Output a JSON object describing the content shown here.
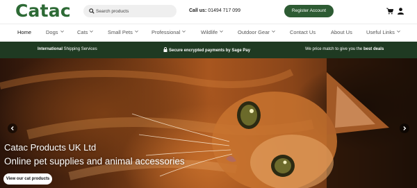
{
  "header": {
    "logo": "Catac",
    "search": {
      "placeholder": "Search products",
      "icon": "search-icon"
    },
    "call_label": "Call us:",
    "call_number": "01494 717 099",
    "register_label": "Register Account",
    "icons": [
      "cart-icon",
      "user-icon"
    ],
    "brand_color": "#2d6a35"
  },
  "nav": {
    "items": [
      {
        "label": "Home",
        "dropdown": false,
        "active": true
      },
      {
        "label": "Dogs",
        "dropdown": true
      },
      {
        "label": "Cats",
        "dropdown": true
      },
      {
        "label": "Small Pets",
        "dropdown": true
      },
      {
        "label": "Professional",
        "dropdown": true
      },
      {
        "label": "Wildlife",
        "dropdown": true
      },
      {
        "label": "Outdoor Gear",
        "dropdown": true
      },
      {
        "label": "Contact Us",
        "dropdown": false
      },
      {
        "label": "About Us",
        "dropdown": false
      },
      {
        "label": "Useful Links",
        "dropdown": true
      }
    ]
  },
  "promo": {
    "international_bold": "International",
    "international_rest": " Shipping Services",
    "secure": "Secure encrypted payments by Sage Pay",
    "price_match_rest": "We price match to give you the ",
    "price_match_bold": "best deals",
    "background": "#1f3a22"
  },
  "hero": {
    "title": "Catac Products UK Ltd",
    "subtitle": "Online pet supplies and animal accessories",
    "button_label": "View our cat products",
    "prev_icon": "chevron-left-icon",
    "next_icon": "chevron-right-icon"
  }
}
